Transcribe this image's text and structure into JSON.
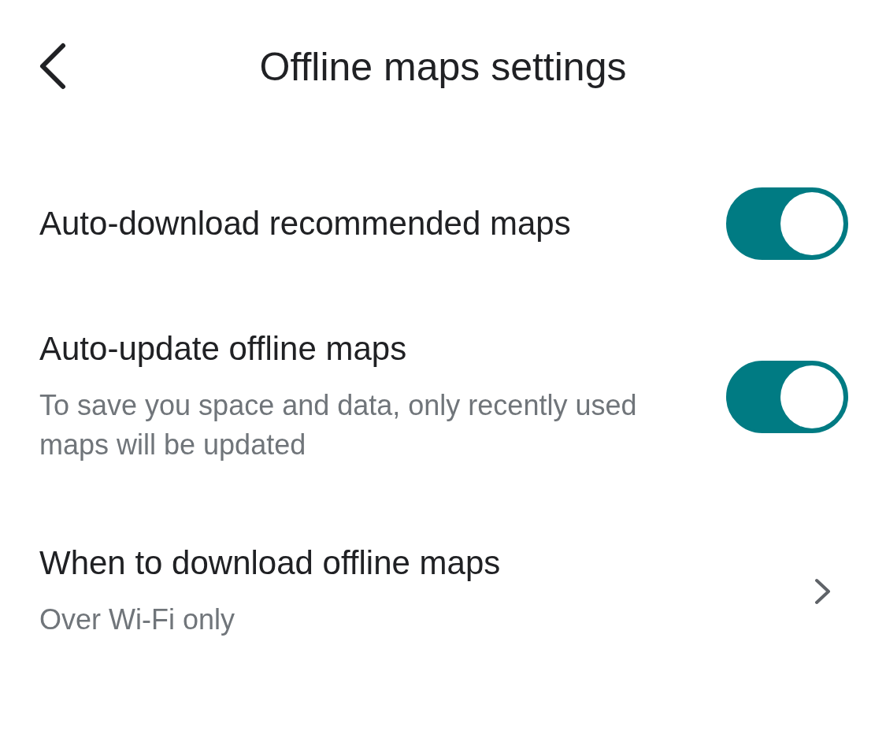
{
  "header": {
    "title": "Offline maps settings"
  },
  "settings": [
    {
      "kind": "toggle",
      "label": "Auto-download recommended maps",
      "on": true
    },
    {
      "kind": "toggle",
      "label": "Auto-update offline maps",
      "description": "To save you space and data, only recently used maps will be updated",
      "on": true
    },
    {
      "kind": "link",
      "label": "When to download offline maps",
      "description": "Over Wi-Fi only"
    }
  ]
}
